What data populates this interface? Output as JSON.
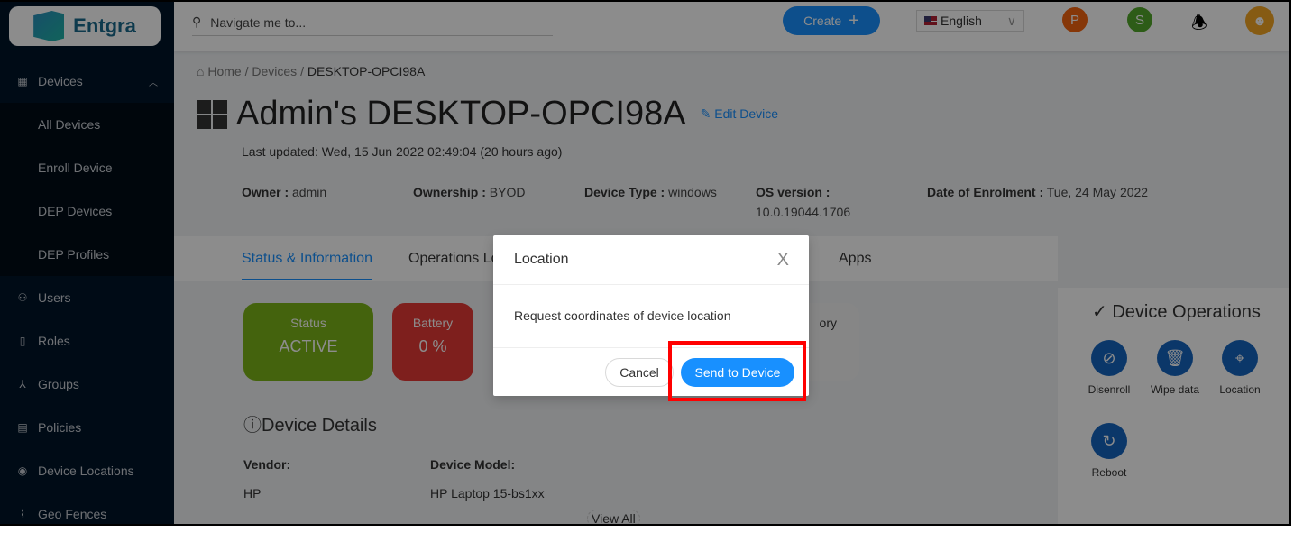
{
  "brand": {
    "name": "Entgra"
  },
  "sidebar": {
    "items": [
      {
        "label": "Devices",
        "icon": "grid-icon",
        "expanded": true
      },
      {
        "label": "All Devices"
      },
      {
        "label": "Enroll Device"
      },
      {
        "label": "DEP Devices"
      },
      {
        "label": "DEP Profiles"
      },
      {
        "label": "Users",
        "icon": "user-icon"
      },
      {
        "label": "Roles",
        "icon": "file-icon"
      },
      {
        "label": "Groups",
        "icon": "cluster-icon"
      },
      {
        "label": "Policies",
        "icon": "policy-icon"
      },
      {
        "label": "Device Locations",
        "icon": "location-pin-icon"
      },
      {
        "label": "Geo Fences",
        "icon": "geofence-icon"
      }
    ]
  },
  "header": {
    "search_placeholder": "Navigate me to...",
    "create_label": "Create",
    "language": "English",
    "avatars": [
      {
        "letter": "P",
        "color": "#f5650f"
      },
      {
        "letter": "S",
        "color": "#52a82a"
      }
    ]
  },
  "breadcrumb": [
    "Home",
    "Devices",
    "DESKTOP-OPCI98A"
  ],
  "device": {
    "title": "Admin's DESKTOP-OPCI98A",
    "edit_label": "Edit Device",
    "last_updated": "Last updated: Wed, 15 Jun 2022 02:49:04 (20 hours ago)",
    "meta": [
      {
        "k": "Owner :",
        "v": "admin"
      },
      {
        "k": "Ownership :",
        "v": "BYOD"
      },
      {
        "k": "Device Type :",
        "v": "windows"
      },
      {
        "k": "OS version :",
        "v": "10.0.19044.1706"
      },
      {
        "k": "Date of Enrolment :",
        "v": "Tue, 24 May 2022"
      }
    ]
  },
  "tabs": [
    {
      "label": "Status & Information",
      "active": true
    },
    {
      "label": "Operations Log"
    },
    {
      "label": "Apps"
    }
  ],
  "cards": [
    {
      "label": "Status",
      "value": "ACTIVE",
      "color": "#7cb518"
    },
    {
      "label": "Battery",
      "value": "0 %",
      "color": "#e53935"
    },
    {
      "label": "ory"
    }
  ],
  "details": {
    "title": "Device Details",
    "vendor_label": "Vendor",
    "vendor": "HP",
    "model_label": "Device Model",
    "model": "HP Laptop 15-bs1xx",
    "view_all": "View All"
  },
  "operations": {
    "title": "Device Operations",
    "items": [
      {
        "label": "Disenroll"
      },
      {
        "label": "Wipe data"
      },
      {
        "label": "Location"
      },
      {
        "label": "Reboot"
      }
    ]
  },
  "modal": {
    "title": "Location",
    "body": "Request coordinates of device location",
    "cancel": "Cancel",
    "confirm": "Send to Device"
  }
}
